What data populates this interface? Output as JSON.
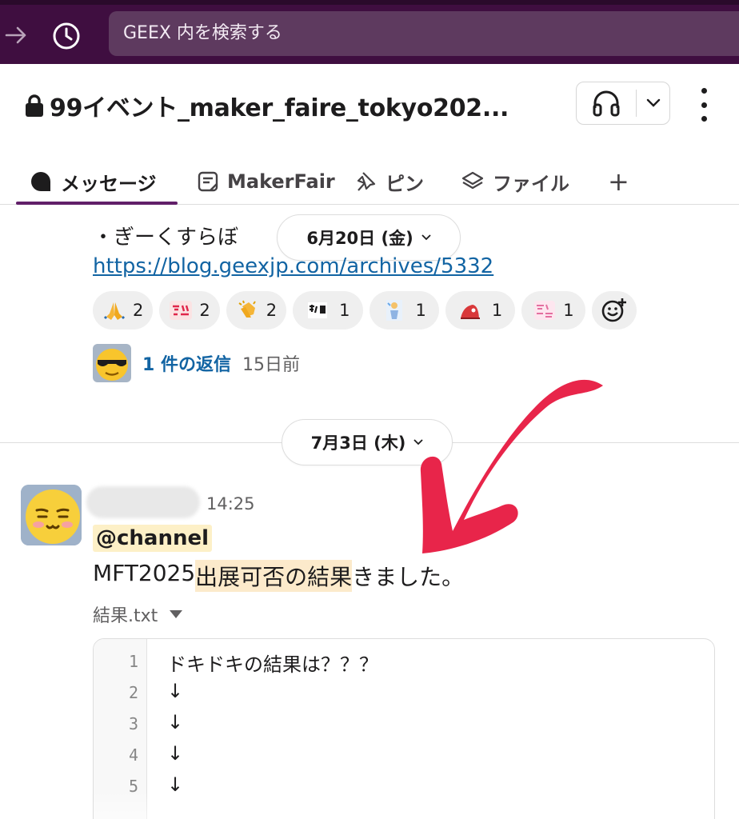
{
  "search": {
    "placeholder": "GEEX 内を検索する"
  },
  "channel": {
    "name": "99イベント_maker_faire_tokyo202..."
  },
  "tabs": [
    {
      "label": "メッセージ",
      "icon": "chat-bubble-icon"
    },
    {
      "label": "MakerFair",
      "icon": "canvas-doc-icon"
    },
    {
      "label": "ピン",
      "icon": "pin-icon"
    },
    {
      "label": "ファイル",
      "icon": "layers-icon"
    },
    {
      "label": "+",
      "icon": "plus-icon"
    }
  ],
  "prev_message": {
    "bullet_text": "・ぎーくすらぼ",
    "link": "https://blog.geexjp.com/archives/5332",
    "reactions": [
      {
        "icon": "folded-hands-emoji",
        "count": "2"
      },
      {
        "icon": "arigatou-emoji",
        "count": "2"
      },
      {
        "icon": "clapping-hands-emoji",
        "count": "2"
      },
      {
        "icon": "custom-text-emoji",
        "count": "1"
      },
      {
        "icon": "custom-figure-emoji",
        "count": "1"
      },
      {
        "icon": "custom-red-emoji",
        "count": "1"
      },
      {
        "icon": "arigatou-gozaimasu-emoji",
        "count": "1"
      }
    ],
    "thread": {
      "replies": "1 件の返信",
      "ago": "15日前"
    }
  },
  "date_pills": {
    "first": "6月20日 (金)",
    "second": "7月3日 (木)"
  },
  "message": {
    "time": "14:25",
    "mention": "@channel",
    "text_before": "MFT2025",
    "text_highlight": "出展可否の結果",
    "text_after": "きました。",
    "file_name": "結果.txt",
    "lines": [
      {
        "num": "1",
        "text": "ドキドキの結果は？？？"
      },
      {
        "num": "2",
        "text": "↓"
      },
      {
        "num": "3",
        "text": "↓"
      },
      {
        "num": "4",
        "text": "↓"
      },
      {
        "num": "5",
        "text": "↓"
      }
    ]
  },
  "colors": {
    "sidebar_purple": "#3f0e40",
    "link_blue": "#1264a3",
    "annotation_red": "#e8254a"
  }
}
